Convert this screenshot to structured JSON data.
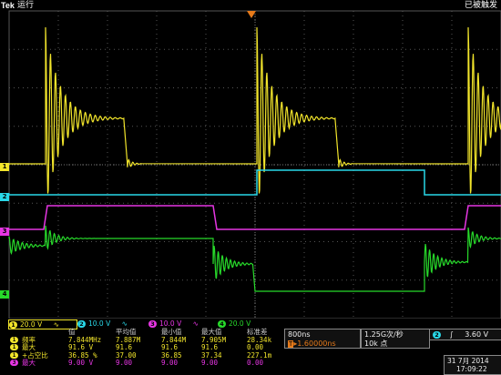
{
  "header": {
    "brand": "Tek",
    "run_status": "运行",
    "trigger_status": "已被触发"
  },
  "channels": [
    {
      "id": "1",
      "color": "#f2e52b",
      "scale": "20.0 V",
      "coupling_sym": "∿"
    },
    {
      "id": "2",
      "color": "#29d8e8",
      "scale": "10.0 V",
      "coupling_sym": "∿"
    },
    {
      "id": "3",
      "color": "#e636e3",
      "scale": "10.0 V",
      "coupling_sym": "∿"
    },
    {
      "id": "4",
      "color": "#27d92a",
      "scale": "20.0 V",
      "coupling_sym": "∿"
    }
  ],
  "scale_bar": {
    "ch1_badge": "1",
    "ch1_scale": "20.0 V",
    "ch1_sym": "∿",
    "ch2_badge": "2",
    "ch2_scale": "10.0 V",
    "ch2_sym": "∿",
    "ch3_badge": "3",
    "ch3_scale": "10.0 V",
    "ch3_sym": "∿",
    "ch4_badge": "4",
    "ch4_scale": "20.0 V"
  },
  "measurements": {
    "headers": [
      "值",
      "平均值",
      "最小值",
      "最大值",
      "标准差"
    ],
    "rows": [
      {
        "badge": "1",
        "badge_color": "#f2e52b",
        "text_color": "#f2e52b",
        "label": "频率",
        "values": [
          "7.844MHz",
          "7.887M",
          "7.844M",
          "7.905M",
          "28.34k"
        ]
      },
      {
        "badge": "1",
        "badge_color": "#f2e52b",
        "text_color": "#f2e52b",
        "label": "最大",
        "values": [
          "91.6 V",
          "91.6",
          "91.6",
          "91.6",
          "0.00"
        ]
      },
      {
        "badge": "1",
        "badge_color": "#f2e52b",
        "text_color": "#f2e52b",
        "label": "+占空比",
        "values": [
          "36.85 %",
          "37.00",
          "36.85",
          "37.34",
          "227.1m"
        ]
      },
      {
        "badge": "3",
        "badge_color": "#e636e3",
        "text_color": "#e636e3",
        "label": "最大",
        "values": [
          "9.00 V",
          "9.00",
          "9.00",
          "9.00",
          "0.00"
        ]
      }
    ]
  },
  "timebase": {
    "horizontal_scale": "800ns",
    "trigger_position_icon": "T",
    "trigger_position": "1.60000ns",
    "sample_rate": "1.25G次/秒",
    "record_length": "10k 点"
  },
  "trigger": {
    "source": "2",
    "slope_icon": "rising-edge",
    "slope_glyph": "∫",
    "level": "3.60 V"
  },
  "datetime": {
    "date": "31 7月  2014",
    "time": "17:09:22"
  },
  "waveforms": {
    "ch1": {
      "ground_marker": "1",
      "description_label": "ringing square pulse"
    },
    "ch2": {
      "ground_marker": "2"
    },
    "ch3": {
      "ground_marker": "3"
    },
    "ch4": {
      "ground_marker": "4"
    }
  }
}
